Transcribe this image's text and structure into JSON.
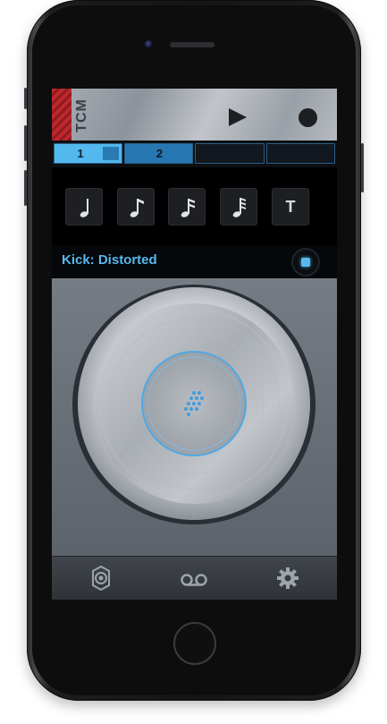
{
  "app": {
    "brand": "TCM"
  },
  "transport": {
    "play_icon": "play-icon",
    "record_icon": "record-icon"
  },
  "patterns": {
    "items": [
      {
        "label": "1",
        "state": "selected"
      },
      {
        "label": "2",
        "state": "active"
      },
      {
        "label": "",
        "state": "empty"
      },
      {
        "label": "",
        "state": "empty"
      }
    ]
  },
  "note_values": {
    "items": [
      {
        "icon": "quarter-note-icon"
      },
      {
        "icon": "eighth-note-icon"
      },
      {
        "icon": "sixteenth-note-icon"
      },
      {
        "icon": "thirtysecond-note-icon"
      },
      {
        "label": "T"
      }
    ]
  },
  "sound": {
    "name": "Kick: Distorted",
    "toggle_icon": "square-dot-icon"
  },
  "pad": {
    "center_icon": "dot-grid-icon"
  },
  "toolbar": {
    "items": [
      {
        "icon": "speaker-icon"
      },
      {
        "icon": "tape-icon"
      },
      {
        "icon": "gear-icon"
      }
    ]
  },
  "colors": {
    "accent": "#52b8ee",
    "record_stripe": "#c0272d",
    "screen_bg": "#5b616a"
  }
}
